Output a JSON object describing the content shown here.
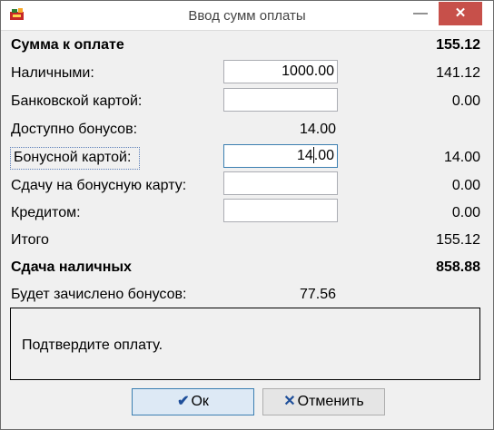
{
  "window": {
    "title": "Ввод сумм оплаты"
  },
  "titlebar": {
    "minimize": "—",
    "close": "✕"
  },
  "rows": {
    "total_due": {
      "label": "Сумма к оплате",
      "value": "155.12"
    },
    "cash": {
      "label": "Наличными:",
      "input": "1000.00",
      "value": "141.12"
    },
    "bank_card": {
      "label": "Банковской картой:",
      "input": "",
      "value": "0.00"
    },
    "bonus_available": {
      "label": "Доступно бонусов:",
      "value": "14.00"
    },
    "bonus_card": {
      "label": "Бонусной картой:",
      "input_before_caret": "14",
      "input_after_caret": ".00",
      "value": "14.00"
    },
    "change_to_bonus": {
      "label": "Сдачу на бонусную карту:",
      "input": "",
      "value": "0.00"
    },
    "credit": {
      "label": "Кредитом:",
      "input": "",
      "value": "0.00"
    },
    "total": {
      "label": "Итого",
      "value": "155.12"
    },
    "cash_change": {
      "label": "Сдача наличных",
      "value": "858.88"
    },
    "bonus_credit": {
      "label": "Будет зачислено бонусов:",
      "value": "77.56"
    }
  },
  "message": "Подтвердите оплату.",
  "buttons": {
    "ok": "Ок",
    "cancel": "Отменить"
  },
  "icons": {
    "app": "app-icon",
    "ok": "check-icon",
    "cancel": "x-icon"
  },
  "colors": {
    "close_button": "#c7504a",
    "focus_border": "#3c7fb1",
    "icon_blue": "#1f4f9a"
  }
}
